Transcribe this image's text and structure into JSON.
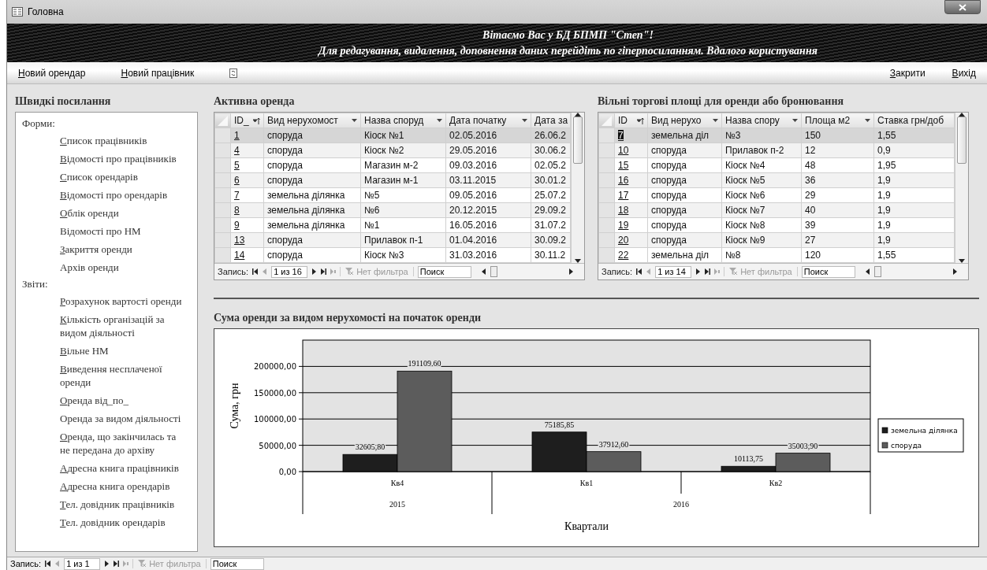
{
  "window": {
    "title": "Головна"
  },
  "banner": {
    "lines": [
      "Вітаємо Вас у БД БПМП \"Степ\"!",
      "Для редагування, видалення, доповнення даних перейдіть по гіперпосиланням. Вдалого користування"
    ]
  },
  "toolbar": {
    "left": [
      "Новий орендар",
      "Новий працівник"
    ],
    "right": [
      "Закрити",
      "Вихід"
    ]
  },
  "quick_links": {
    "title": "Швидкі посилання",
    "sections": [
      {
        "label": "Форми:",
        "items": [
          {
            "label": "Список працівників",
            "underlined": true
          },
          {
            "label": "Відомості про працівників",
            "underlined": true
          },
          {
            "label": "Список орендарів",
            "underlined": true
          },
          {
            "label": "Відомості про орендарів",
            "underlined": true
          },
          {
            "label": "Облік оренди",
            "underlined": true
          },
          {
            "label": "Відомості про НМ",
            "underlined": false
          },
          {
            "label": "Закриття оренди",
            "underlined": true
          },
          {
            "label": "Архів оренди",
            "underlined": false
          }
        ]
      },
      {
        "label": "Звіти:",
        "items": [
          {
            "label": "Розрахунок вартості оренди",
            "underlined": true
          },
          {
            "label": "Кількість організацій за видом діяльності",
            "underlined": true
          },
          {
            "label": "Вільне НМ",
            "underlined": true
          },
          {
            "label": "Виведення несплаченої оренди",
            "underlined": true
          },
          {
            "label": "Оренда від_по_",
            "underlined": true
          },
          {
            "label": "Оренда за видом діяльності",
            "underlined": false
          },
          {
            "label": "Оренда, що  закінчилась та не передана до архіву",
            "underlined": true
          },
          {
            "label": "Адресна книга працівників",
            "underlined": true
          },
          {
            "label": "Адресна книга орендарів",
            "underlined": true
          },
          {
            "label": "Тел. довідник працівників",
            "underlined": true
          },
          {
            "label": "Тел. довідник орендарів",
            "underlined": true
          }
        ]
      }
    ]
  },
  "active_lease": {
    "title": "Активна оренда",
    "columns": [
      {
        "label": "ID_",
        "kind": "sorted"
      },
      {
        "label": "Вид нерухомост",
        "kind": "menu"
      },
      {
        "label": "Назва споруд",
        "kind": "menu"
      },
      {
        "label": "Дата початку",
        "kind": "menu"
      },
      {
        "label": "Дата за",
        "kind": "plain"
      }
    ],
    "rows": [
      {
        "cells": [
          "1",
          "споруда",
          "Кіоск №1",
          "02.05.2016",
          "26.06.2"
        ],
        "selected": true,
        "id_highlighted": false
      },
      {
        "cells": [
          "4",
          "споруда",
          "Кіоск №2",
          "29.05.2016",
          "30.06.2"
        ],
        "selected": false,
        "id_highlighted": false
      },
      {
        "cells": [
          "5",
          "споруда",
          "Магазин м-2",
          "09.03.2016",
          "02.05.2"
        ],
        "selected": false,
        "id_highlighted": false
      },
      {
        "cells": [
          "6",
          "споруда",
          "Магазин м-1",
          "03.11.2015",
          "30.01.2"
        ],
        "selected": false,
        "id_highlighted": false
      },
      {
        "cells": [
          "7",
          "земельна ділянка",
          "№5",
          "09.05.2016",
          "25.07.2"
        ],
        "selected": false,
        "id_highlighted": false
      },
      {
        "cells": [
          "8",
          "земельна ділянка",
          "№6",
          "20.12.2015",
          "29.09.2"
        ],
        "selected": false,
        "id_highlighted": false
      },
      {
        "cells": [
          "9",
          "земельна ділянка",
          "№1",
          "16.05.2016",
          "31.07.2"
        ],
        "selected": false,
        "id_highlighted": false
      },
      {
        "cells": [
          "13",
          "споруда",
          "Прилавок п-1",
          "01.04.2016",
          "30.09.2"
        ],
        "selected": false,
        "id_highlighted": false
      },
      {
        "cells": [
          "14",
          "споруда",
          "Кіоск №3",
          "31.03.2016",
          "30.11.2"
        ],
        "selected": false,
        "id_highlighted": false
      }
    ],
    "nav": {
      "label": "Запись:",
      "position": "1 из 16",
      "filter": "Нет фильтра",
      "search_value": "Поиск"
    }
  },
  "free_areas": {
    "title": "Вільні торгові площі для оренди або бронювання",
    "columns": [
      {
        "label": "ID",
        "kind": "sorted"
      },
      {
        "label": "Вид нерухо",
        "kind": "menu"
      },
      {
        "label": "Назва спору",
        "kind": "menu"
      },
      {
        "label": "Площа м2",
        "kind": "menu"
      },
      {
        "label": "Ставка грн/доб",
        "kind": "plain"
      }
    ],
    "rows": [
      {
        "cells": [
          "7",
          "земельна діл",
          "№3",
          "150",
          "1,55"
        ],
        "selected": true,
        "id_highlighted": true
      },
      {
        "cells": [
          "10",
          "споруда",
          "Прилавок п-2",
          "12",
          "0,9"
        ],
        "selected": false,
        "id_highlighted": false
      },
      {
        "cells": [
          "15",
          "споруда",
          "Кіоск №4",
          "48",
          "1,95"
        ],
        "selected": false,
        "id_highlighted": false
      },
      {
        "cells": [
          "16",
          "споруда",
          "Кіоск №5",
          "36",
          "1,9"
        ],
        "selected": false,
        "id_highlighted": false
      },
      {
        "cells": [
          "17",
          "споруда",
          "Кіоск №6",
          "29",
          "1,9"
        ],
        "selected": false,
        "id_highlighted": false
      },
      {
        "cells": [
          "18",
          "споруда",
          "Кіоск №7",
          "40",
          "1,9"
        ],
        "selected": false,
        "id_highlighted": false
      },
      {
        "cells": [
          "19",
          "споруда",
          "Кіоск №8",
          "39",
          "1,9"
        ],
        "selected": false,
        "id_highlighted": false
      },
      {
        "cells": [
          "20",
          "споруда",
          "Кіоск №9",
          "27",
          "1,9"
        ],
        "selected": false,
        "id_highlighted": false
      },
      {
        "cells": [
          "22",
          "земельна діл",
          "№8",
          "120",
          "1,55"
        ],
        "selected": false,
        "id_highlighted": false
      }
    ],
    "nav": {
      "label": "Запись:",
      "position": "1 из 14",
      "filter": "Нет фильтра",
      "search_value": "Поиск"
    }
  },
  "chart": {
    "title": "Сума оренди за видом нерухомості на початок оренди",
    "year_groups": [
      {
        "label": "2015",
        "kind": "single"
      },
      {
        "label": "2016",
        "kind": "pair"
      }
    ],
    "chart_data": {
      "type": "bar",
      "xlabel": "Квартали",
      "ylabel": "Сума, грн",
      "categories": [
        "Кв4",
        "Кв1",
        "Кв2"
      ],
      "series": [
        {
          "name": "земельна ділянка",
          "color": "#1e1e1e",
          "values": [
            32605.8,
            75185.85,
            10113.75
          ]
        },
        {
          "name": "споруда",
          "color": "#5c5c5c",
          "values": [
            191109.6,
            37912.6,
            35003.9
          ]
        }
      ],
      "ylim": [
        0,
        250000
      ],
      "grid": true,
      "legend": true,
      "yticks": [
        {
          "value": 0,
          "label": "0,00"
        },
        {
          "value": 50000,
          "label": "50000,00"
        },
        {
          "value": 100000,
          "label": "100000,00"
        },
        {
          "value": 150000,
          "label": "150000,00"
        },
        {
          "value": 200000,
          "label": "200000,00"
        }
      ],
      "value_labels": [
        [
          "32605,80",
          "75185,85",
          "10113,75"
        ],
        [
          "191109.60",
          "37912,60",
          "35003,90"
        ]
      ]
    }
  },
  "status_nav": {
    "label": "Запись:",
    "position": "1 из 1",
    "filter": "Нет фильтра",
    "search_value": "Поиск"
  }
}
